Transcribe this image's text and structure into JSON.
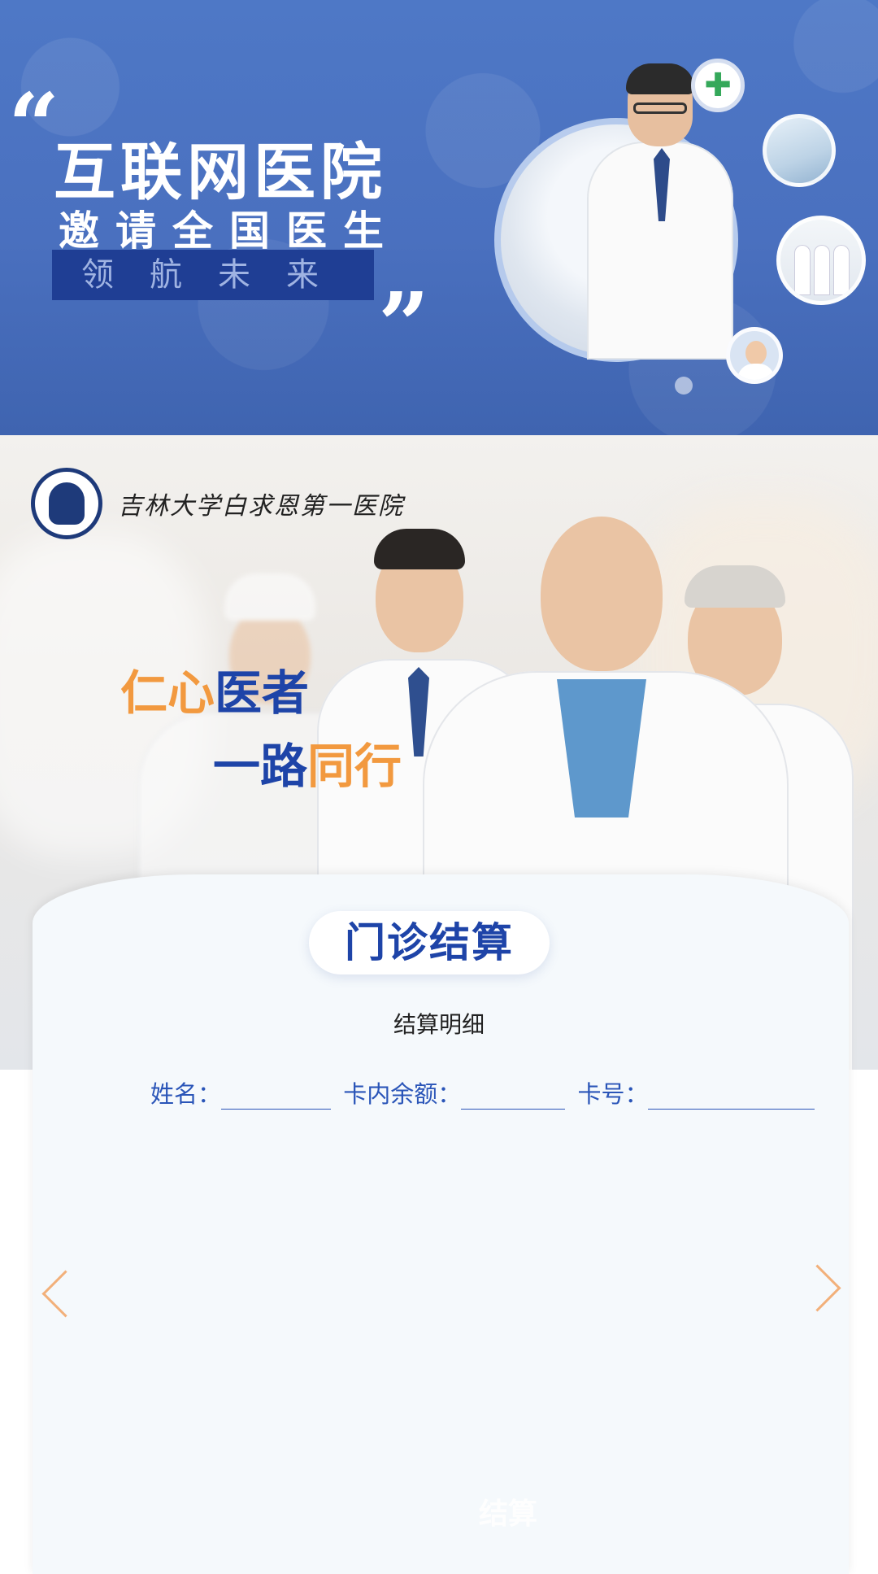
{
  "banner": {
    "title": "互联网医院",
    "subtitle": "邀请全国医生",
    "tagline": "领航未来",
    "quote_open": "“",
    "quote_close": "”",
    "bg_color": "#4a70bf",
    "app_logo_icon": "hospital-plus-logo-icon"
  },
  "hero": {
    "hospital_name": "吉林大学白求恩第一医院",
    "hospital_emblem_icon": "bethune-emblem-icon",
    "slogan_line1": {
      "orange": "仁心",
      "blue": "医者"
    },
    "slogan_line2": {
      "blue": "一路",
      "orange": "同行"
    },
    "accent_orange": "#f2993f",
    "accent_blue": "#1e44a8"
  },
  "card": {
    "section_title": "门诊结算",
    "detail_title": "结算明细",
    "fields": {
      "name_label": "姓名：",
      "balance_label": "卡内余额：",
      "card_no_label": "卡号："
    },
    "prev_icon": "chevron-left-icon",
    "next_icon": "chevron-right-icon",
    "settle_button": "结算"
  }
}
